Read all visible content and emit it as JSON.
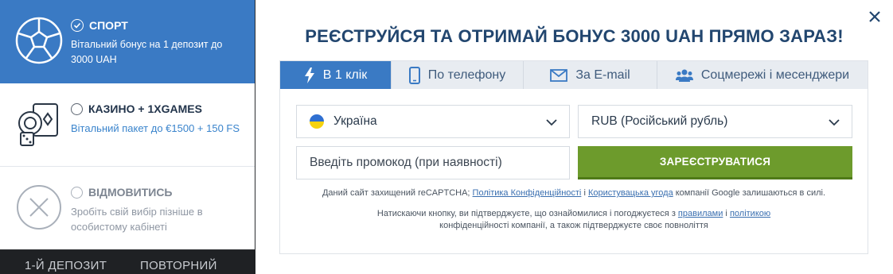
{
  "background": {
    "tab1": "1-Й ДЕПОЗИТ",
    "tab2": "ПОВТОРНИЙ ДЕПОЗ"
  },
  "bonuses": {
    "sport": {
      "title": "СПОРТ",
      "desc": "Вітальний бонус на 1 депозит до 3000 UAH",
      "icon": "soccer-ball-icon"
    },
    "casino": {
      "title": "КАЗИНО + 1XGAMES",
      "desc": "Вітальний пакет до €1500 + 150 FS",
      "icon": "casino-chips-cards-icon"
    },
    "refuse": {
      "title": "ВІДМОВИТИСЬ",
      "desc": "Зробіть свій вибір пізніше в особистому кабінеті",
      "icon": "close-circle-icon"
    }
  },
  "modal": {
    "heading": "РЕЄСТРУЙСЯ ТА ОТРИМАЙ БОНУС 3000 UAH ПРЯМО ЗАРАЗ!",
    "tabs": [
      {
        "label": "В 1 клік",
        "icon": "lightning-icon"
      },
      {
        "label": "По телефону",
        "icon": "phone-icon"
      },
      {
        "label": "За E-mail",
        "icon": "envelope-icon"
      },
      {
        "label": "Соцмережі і месенджери",
        "icon": "users-icon"
      }
    ],
    "country": "Україна",
    "currency": "RUB (Російський рубль)",
    "promo_placeholder": "Введіть промокод (при наявності)",
    "register_button": "ЗАРЕЄСТРУВАТИСЯ",
    "legal1_a": "Даний сайт захищений reCAPTCHA;",
    "legal1_link1": "Політика Конфіденційності",
    "legal1_and": "і",
    "legal1_link2": "Користувацька угода",
    "legal1_b": "компанії Google залишаються в силі.",
    "legal2_a": "Натискаючи кнопку, ви підтверджуєте, що ознайомилися і погоджуєтеся з",
    "legal2_link1": "правилами",
    "legal2_and": "і",
    "legal2_link2": "політикою",
    "legal2_b": "конфіденційності компанії, а також підтверджуєте своє повноліття"
  },
  "colors": {
    "accent": "#3a7ac4",
    "register": "#6d9b2c",
    "heading": "#22466f"
  }
}
